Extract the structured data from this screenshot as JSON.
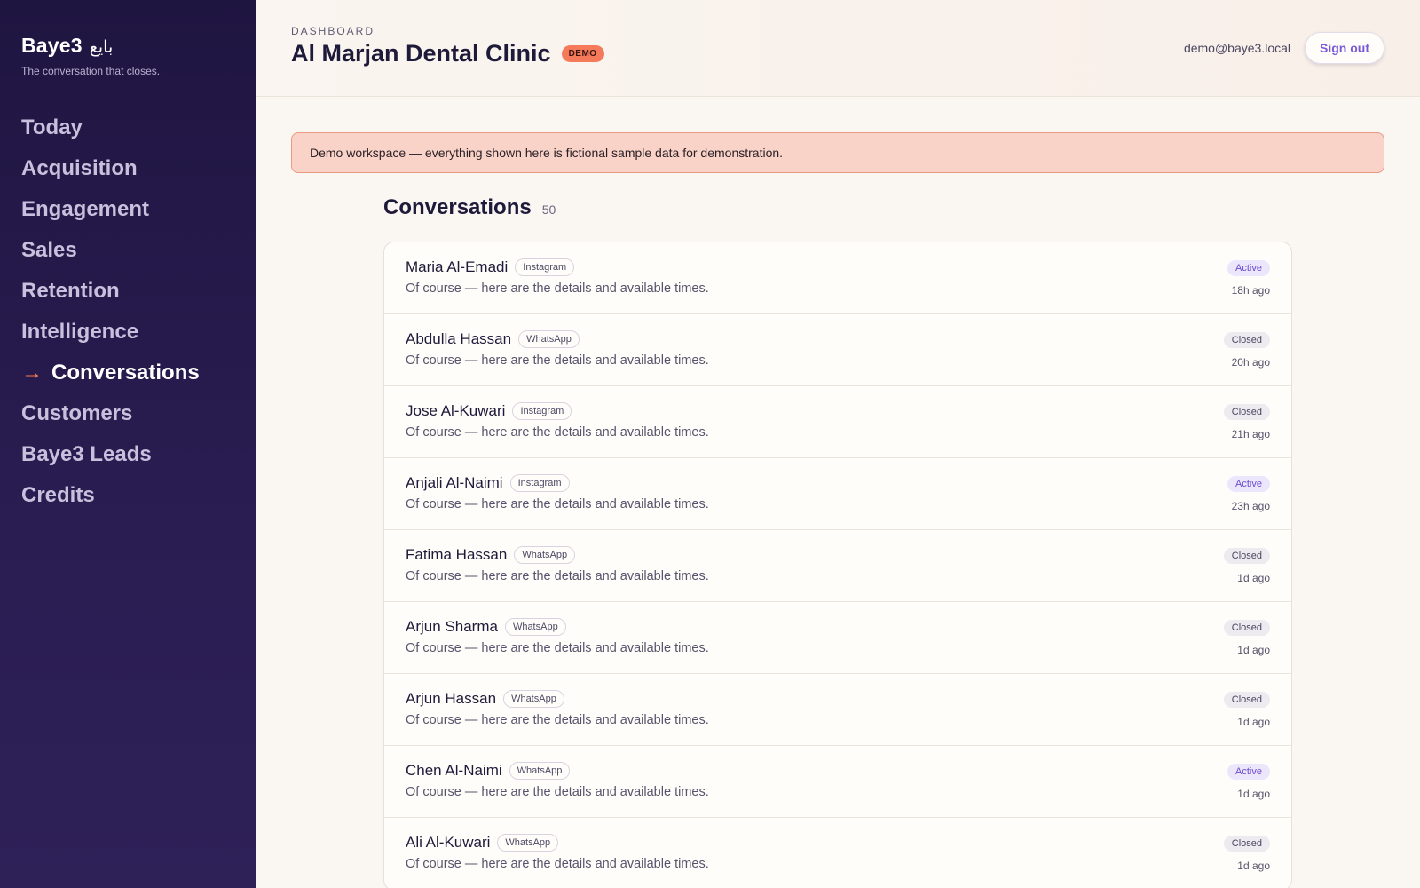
{
  "brand": {
    "name": "Baye3",
    "arabic": "بايع",
    "tagline": "The conversation that closes."
  },
  "nav": {
    "items": [
      {
        "label": "Today"
      },
      {
        "label": "Acquisition"
      },
      {
        "label": "Engagement"
      },
      {
        "label": "Sales"
      },
      {
        "label": "Retention"
      },
      {
        "label": "Intelligence"
      },
      {
        "label": "Conversations",
        "active": true
      },
      {
        "label": "Customers"
      },
      {
        "label": "Baye3 Leads"
      },
      {
        "label": "Credits"
      }
    ],
    "active_icon": "arrow-right-icon"
  },
  "header": {
    "overline": "DASHBOARD",
    "title": "Al Marjan Dental Clinic",
    "badge": "DEMO",
    "user_email": "demo@baye3.local",
    "signout_label": "Sign out"
  },
  "banner": {
    "text": "Demo workspace — everything shown here is fictional sample data for demonstration."
  },
  "conversations": {
    "title": "Conversations",
    "count": "50",
    "rows": [
      {
        "name": "Maria Al-Emadi",
        "channel": "Instagram",
        "snippet": "Of course — here are the details and available times.",
        "status": "Active",
        "time": "18h ago"
      },
      {
        "name": "Abdulla Hassan",
        "channel": "WhatsApp",
        "snippet": "Of course — here are the details and available times.",
        "status": "Closed",
        "time": "20h ago"
      },
      {
        "name": "Jose Al-Kuwari",
        "channel": "Instagram",
        "snippet": "Of course — here are the details and available times.",
        "status": "Closed",
        "time": "21h ago"
      },
      {
        "name": "Anjali Al-Naimi",
        "channel": "Instagram",
        "snippet": "Of course — here are the details and available times.",
        "status": "Active",
        "time": "23h ago"
      },
      {
        "name": "Fatima Hassan",
        "channel": "WhatsApp",
        "snippet": "Of course — here are the details and available times.",
        "status": "Closed",
        "time": "1d ago"
      },
      {
        "name": "Arjun Sharma",
        "channel": "WhatsApp",
        "snippet": "Of course — here are the details and available times.",
        "status": "Closed",
        "time": "1d ago"
      },
      {
        "name": "Arjun Hassan",
        "channel": "WhatsApp",
        "snippet": "Of course — here are the details and available times.",
        "status": "Closed",
        "time": "1d ago"
      },
      {
        "name": "Chen Al-Naimi",
        "channel": "WhatsApp",
        "snippet": "Of course — here are the details and available times.",
        "status": "Active",
        "time": "1d ago"
      },
      {
        "name": "Ali Al-Kuwari",
        "channel": "WhatsApp",
        "snippet": "Of course — here are the details and available times.",
        "status": "Closed",
        "time": "1d ago"
      }
    ]
  },
  "colors": {
    "sidebar_bg": "#231848",
    "accent_orange": "#f47a4f",
    "accent_purple": "#7a5ad8",
    "banner_bg": "#f9d3c7",
    "page_bg": "#faf6f1"
  }
}
